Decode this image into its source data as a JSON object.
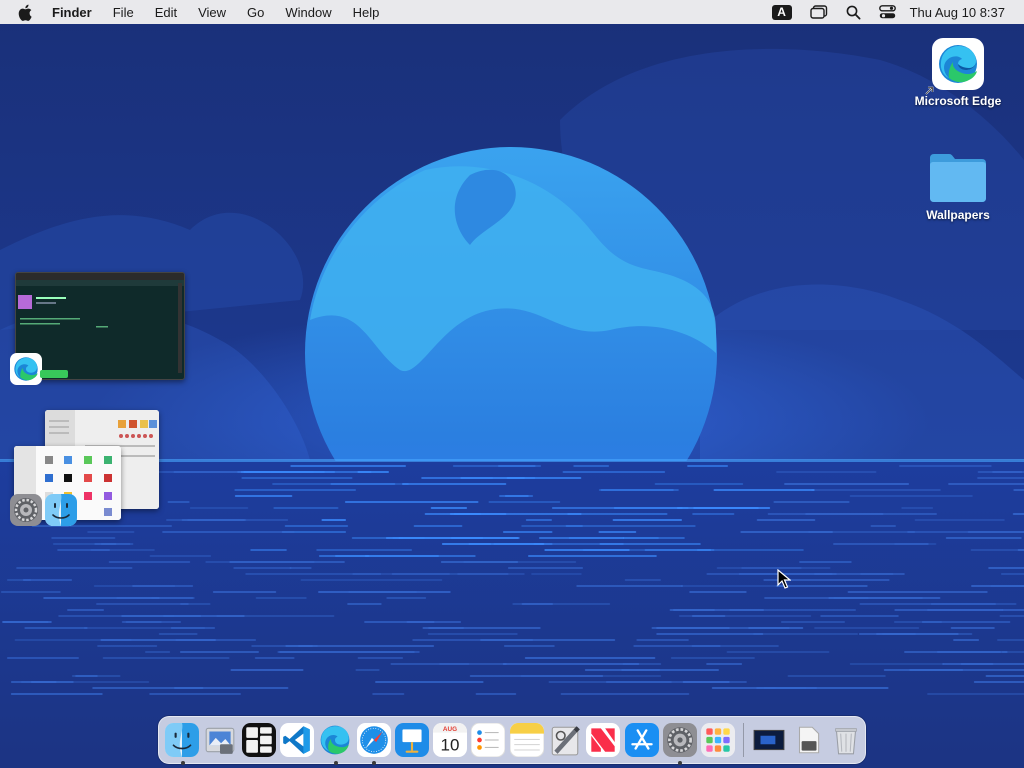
{
  "menubar": {
    "app_name": "Finder",
    "menus": [
      "File",
      "Edit",
      "View",
      "Go",
      "Window",
      "Help"
    ],
    "input_source": "A",
    "clock": "Thu Aug 10  8:37",
    "status_icons": [
      "input-source-icon",
      "stage-manager-icon",
      "spotlight-icon",
      "control-center-icon"
    ]
  },
  "desktop": {
    "icons": [
      {
        "label": "Microsoft Edge",
        "icon": "edge-icon"
      },
      {
        "label": "Wallpapers",
        "icon": "folder-icon"
      }
    ]
  },
  "stage_manager": {
    "groups": [
      {
        "app": "Microsoft Edge",
        "icon": "edge-icon"
      },
      {
        "apps": [
          "System Settings",
          "Finder"
        ],
        "icons": [
          "settings-icon",
          "finder-icon"
        ]
      }
    ]
  },
  "dock": {
    "items": [
      {
        "name": "Finder",
        "icon": "finder-icon",
        "running": true
      },
      {
        "name": "Preview",
        "icon": "preview-icon",
        "running": false
      },
      {
        "name": "Mission Control",
        "icon": "mission-control-icon",
        "running": false
      },
      {
        "name": "Visual Studio Code",
        "icon": "vscode-icon",
        "running": false
      },
      {
        "name": "Microsoft Edge",
        "icon": "edge-icon",
        "running": true
      },
      {
        "name": "Safari",
        "icon": "safari-icon",
        "running": true
      },
      {
        "name": "Keynote",
        "icon": "keynote-icon",
        "running": false
      },
      {
        "name": "Calendar",
        "icon": "calendar-icon",
        "running": false,
        "month": "AUG",
        "day": "10"
      },
      {
        "name": "Reminders",
        "icon": "reminders-icon",
        "running": false
      },
      {
        "name": "Notes",
        "icon": "notes-icon",
        "running": false
      },
      {
        "name": "Script Editor",
        "icon": "script-editor-icon",
        "running": false
      },
      {
        "name": "News",
        "icon": "news-icon",
        "running": false
      },
      {
        "name": "App Store",
        "icon": "app-store-icon",
        "running": false
      },
      {
        "name": "System Settings",
        "icon": "settings-icon",
        "running": true
      },
      {
        "name": "Launchpad",
        "icon": "launchpad-icon",
        "running": false
      }
    ],
    "stack_items": [
      {
        "name": "Screenshot",
        "icon": "screenshot-icon"
      },
      {
        "name": "Documents",
        "icon": "document-icon"
      },
      {
        "name": "Trash",
        "icon": "trash-icon"
      }
    ]
  },
  "colors": {
    "wallpaper_sky": "#1c3580",
    "wallpaper_moon": "#2e8de0",
    "menubar": "#e9e9ec",
    "dock": "#ebeef5"
  }
}
